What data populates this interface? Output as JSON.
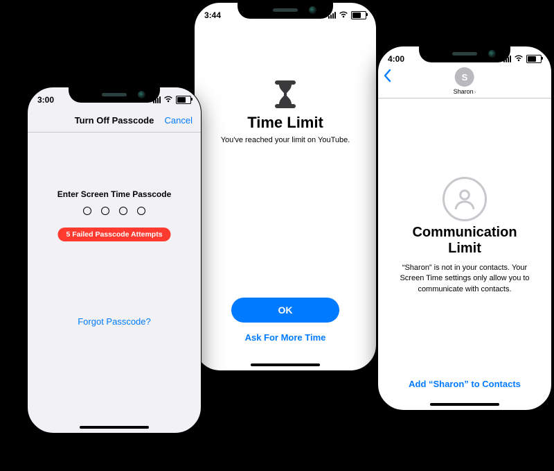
{
  "phone1": {
    "time": "3:00",
    "nav_title": "Turn Off Passcode",
    "cancel": "Cancel",
    "prompt": "Enter Screen Time Passcode",
    "error_pill": "5 Failed Passcode Attempts",
    "forgot": "Forgot Passcode?"
  },
  "phone2": {
    "time": "3:44",
    "heading": "Time Limit",
    "subtext": "You've reached your limit on YouTube.",
    "ok": "OK",
    "ask_more": "Ask For More Time"
  },
  "phone3": {
    "time": "4:00",
    "avatar_initial": "S",
    "avatar_name": "Sharon",
    "heading": "Communication Limit",
    "subtext": "“Sharon” is not in your contacts. Your Screen Time settings only allow you to communicate with contacts.",
    "add_contacts": "Add “Sharon” to Contacts"
  }
}
